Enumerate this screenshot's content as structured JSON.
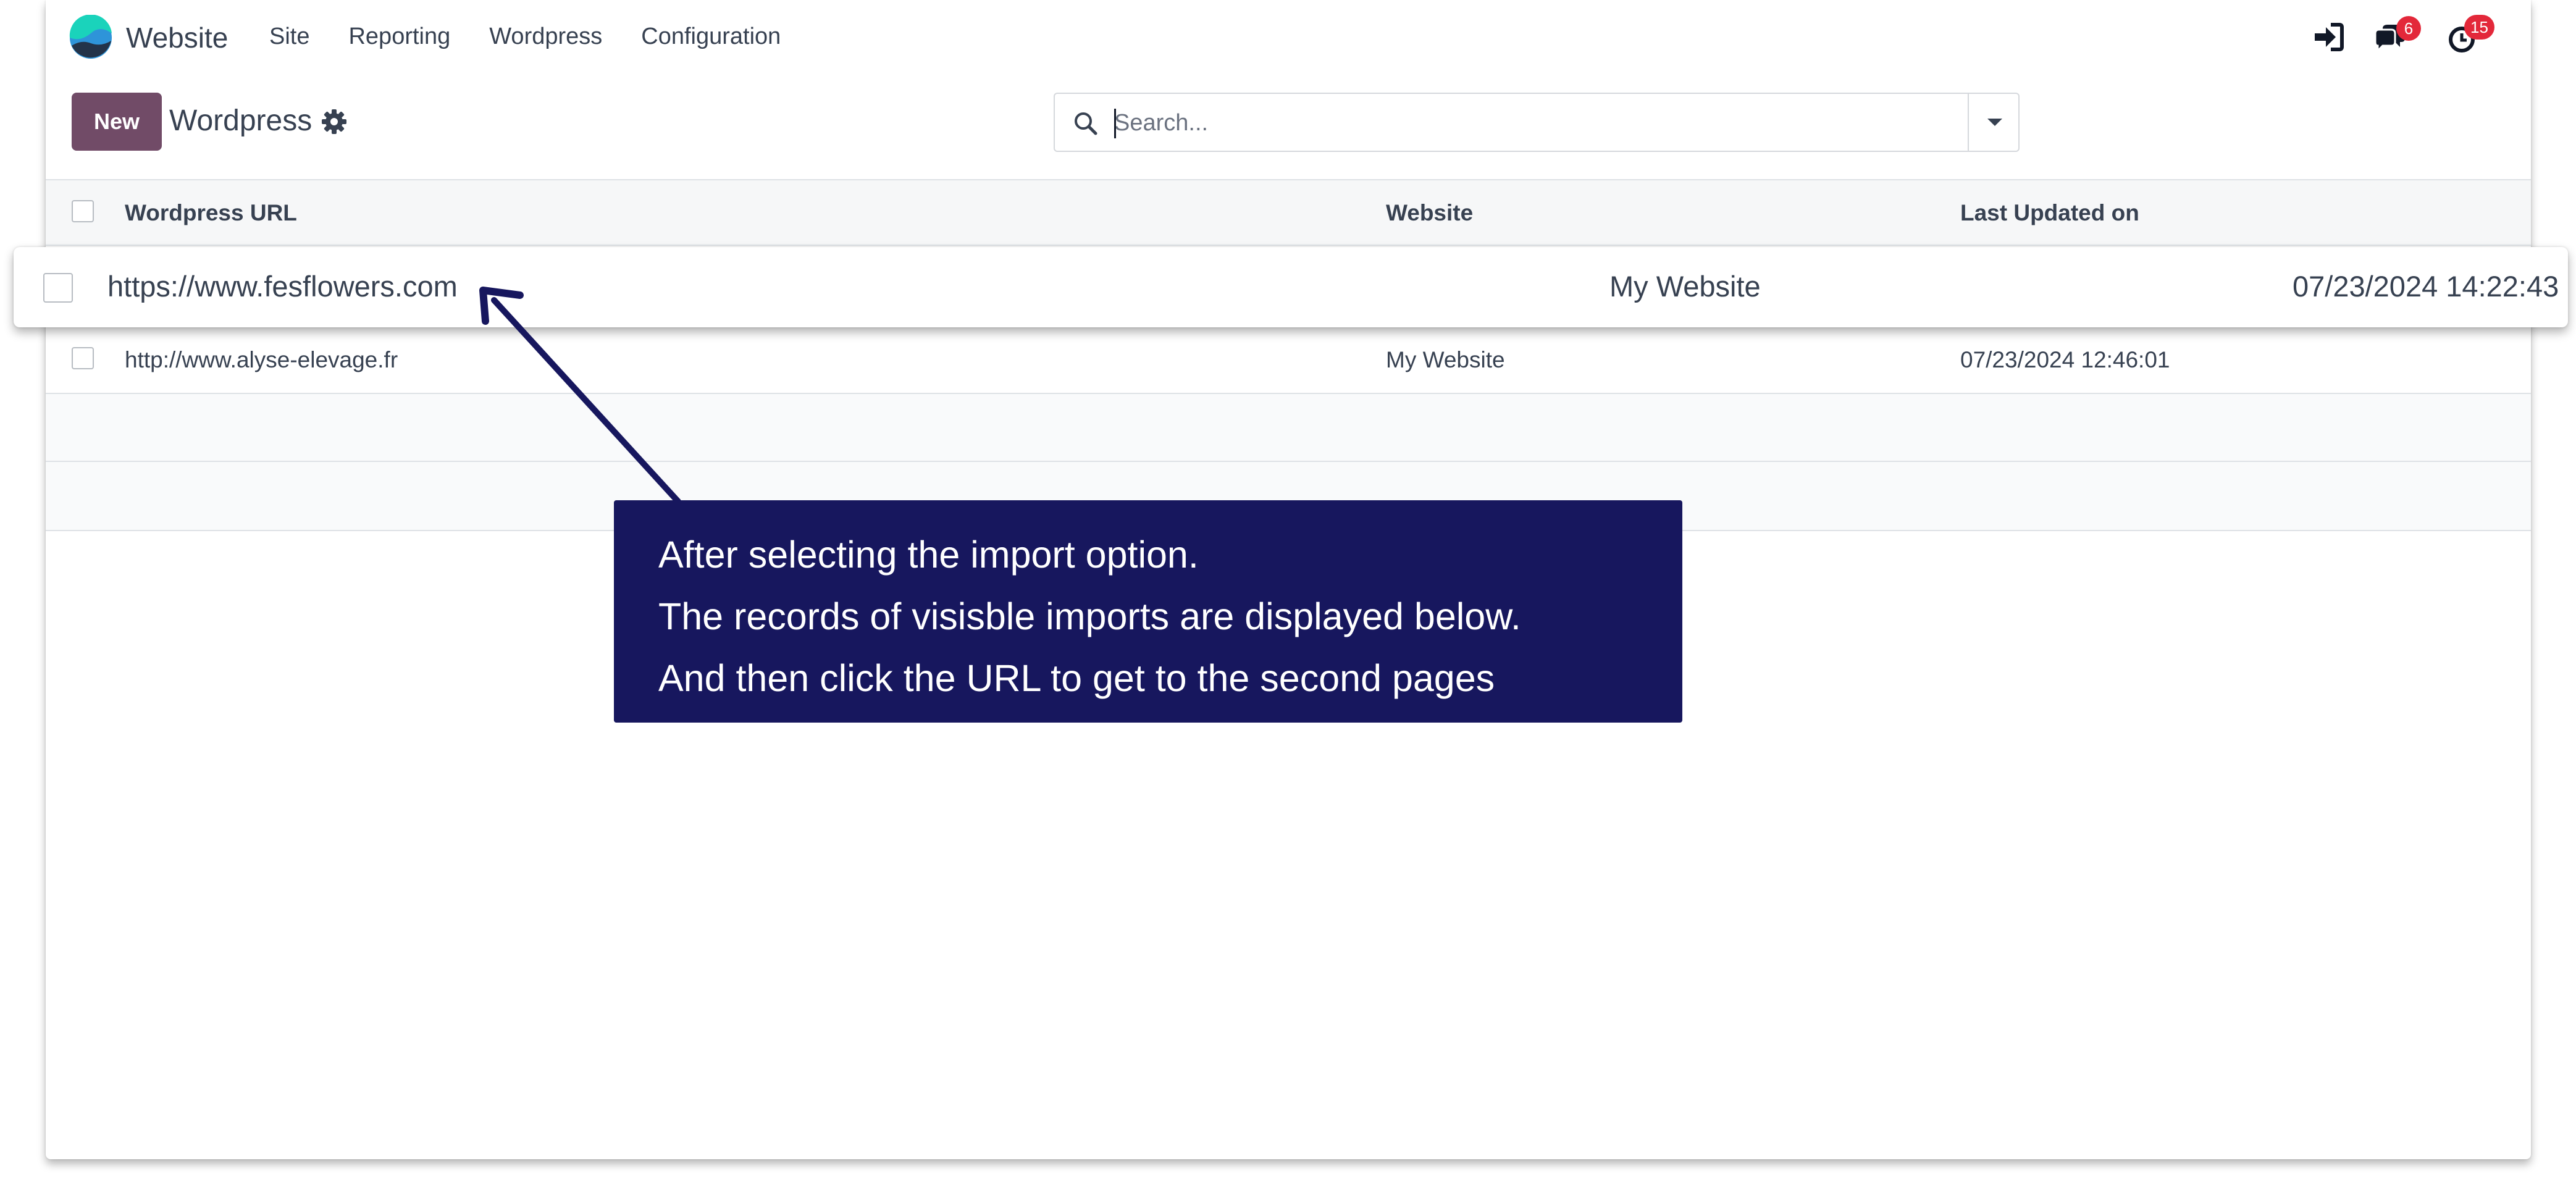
{
  "navbar": {
    "app_name": "Website",
    "menu": [
      "Site",
      "Reporting",
      "Wordpress",
      "Configuration"
    ],
    "messages_count": "6",
    "activities_count": "15"
  },
  "control_panel": {
    "new_label": "New",
    "title": "Wordpress",
    "search_placeholder": "Search..."
  },
  "list": {
    "columns": [
      "Wordpress URL",
      "Website",
      "Last Updated on"
    ],
    "rows": [
      {
        "url": "https://www.fesflowers.com",
        "website": "My Website",
        "updated": "07/23/2024 14:22:43"
      },
      {
        "url": "http://www.alyse-elevage.fr",
        "website": "My Website",
        "updated": "07/23/2024 12:46:01"
      }
    ]
  },
  "annotation": {
    "lines": [
      "After selecting the import option.",
      "The records of visisble imports are displayed below.",
      "And then click the URL to get to the second pages"
    ]
  },
  "colors": {
    "primary": "#714b67",
    "callout": "#17175e",
    "badge": "#e3283a",
    "logo_teal": "#1ad3bb",
    "logo_blue": "#2e94d9",
    "logo_dark": "#233349"
  }
}
